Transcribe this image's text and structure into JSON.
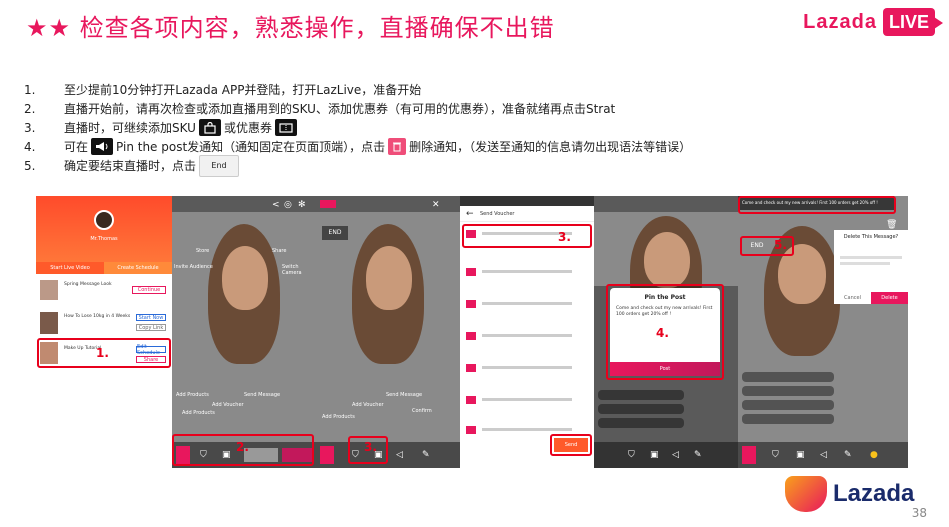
{
  "header": {
    "title": "★★ 检查各项内容，熟悉操作，直播确保不出错",
    "brand_word": "Lazada",
    "brand_live": "LIVE"
  },
  "steps": [
    {
      "num": "1.",
      "text": "至少提前10分钟打开Lazada APP并登陆，打开LazLive，准备开始"
    },
    {
      "num": "2.",
      "text": "直播开始前，请再次检查或添加直播用到的SKU、添加优惠券（有可用的优惠券），准备就绪再点击Strat"
    },
    {
      "num": "3.",
      "pre": "直播时，可继续添加SKU",
      "mid": "或优惠券"
    },
    {
      "num": "4.",
      "pre": "可在",
      "mid": "Pin the post发通知（通知固定在页面顶端），点击",
      "post": "删除通知，（发送至通知的信息请勿出现语法等错误）"
    },
    {
      "num": "5.",
      "pre": "确定要结束直播时，点击",
      "end_label": "End"
    }
  ],
  "screens": {
    "s1": {
      "host": "Mr.Thomas",
      "tab_left": "Start Live Video",
      "tab_right": "Create Schedule",
      "items": [
        {
          "title": "Spring Message Look",
          "btn1": "Continue"
        },
        {
          "title": "How To Lose 10kg in 4 Weeks",
          "btn1": "Start Now",
          "btn2": "Copy Link"
        },
        {
          "title": "Make Up Tutorial",
          "btn1": "Edit Schedule",
          "btn2": "Share"
        }
      ],
      "anno": "1."
    },
    "s2": {
      "labels": [
        "Share",
        "Switch Camera",
        "Store",
        "Invite Audience",
        "Add Products",
        "Add Voucher",
        "Send Message",
        "Add Products"
      ],
      "anno": "2."
    },
    "s3": {
      "end": "END",
      "labels": [
        "Send Message",
        "Add Voucher",
        "Confirm",
        "Add Products"
      ],
      "anno": "3."
    },
    "s4": {
      "header": "Send Voucher",
      "anno": "3.",
      "send": "Send"
    },
    "s5": {
      "title": "Pin the Post",
      "body": "Come and check out my new arrivals! First 100 orders get 20% off !",
      "post": "Post",
      "anno": "4."
    },
    "s6": {
      "pinned": "Come and check out my new arrivals! First 100 orders get 20% off !",
      "end": "END",
      "anno_end": "5.",
      "dialog_title": "Delete This Message?",
      "cancel": "Cancel",
      "delete": "Delete"
    }
  },
  "footer": {
    "brand": "Lazada",
    "page": "38"
  }
}
